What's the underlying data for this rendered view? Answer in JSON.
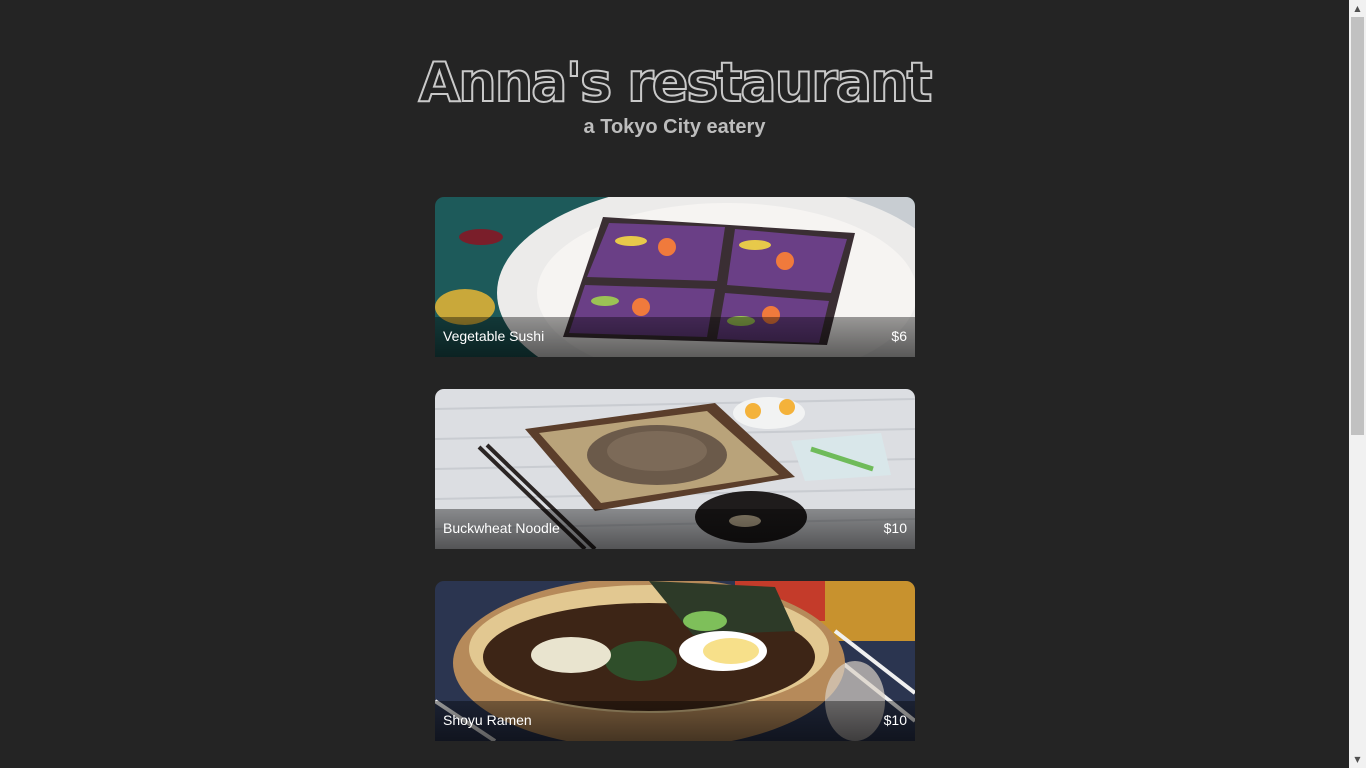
{
  "header": {
    "title": "Anna's restaurant",
    "subtitle": "a Tokyo City eatery"
  },
  "menu": {
    "items": [
      {
        "name": "Vegetable Sushi",
        "price": "$6"
      },
      {
        "name": "Buckwheat Noodle",
        "price": "$10"
      },
      {
        "name": "Shoyu Ramen",
        "price": "$10"
      }
    ]
  },
  "scrollbar": {
    "up_icon": "arrow-up-icon",
    "down_icon": "arrow-down-icon"
  },
  "colors": {
    "background": "#242424",
    "title_outline": "#c9c9c9",
    "subtitle": "#bdbdbd",
    "caption_text": "#ffffff"
  }
}
